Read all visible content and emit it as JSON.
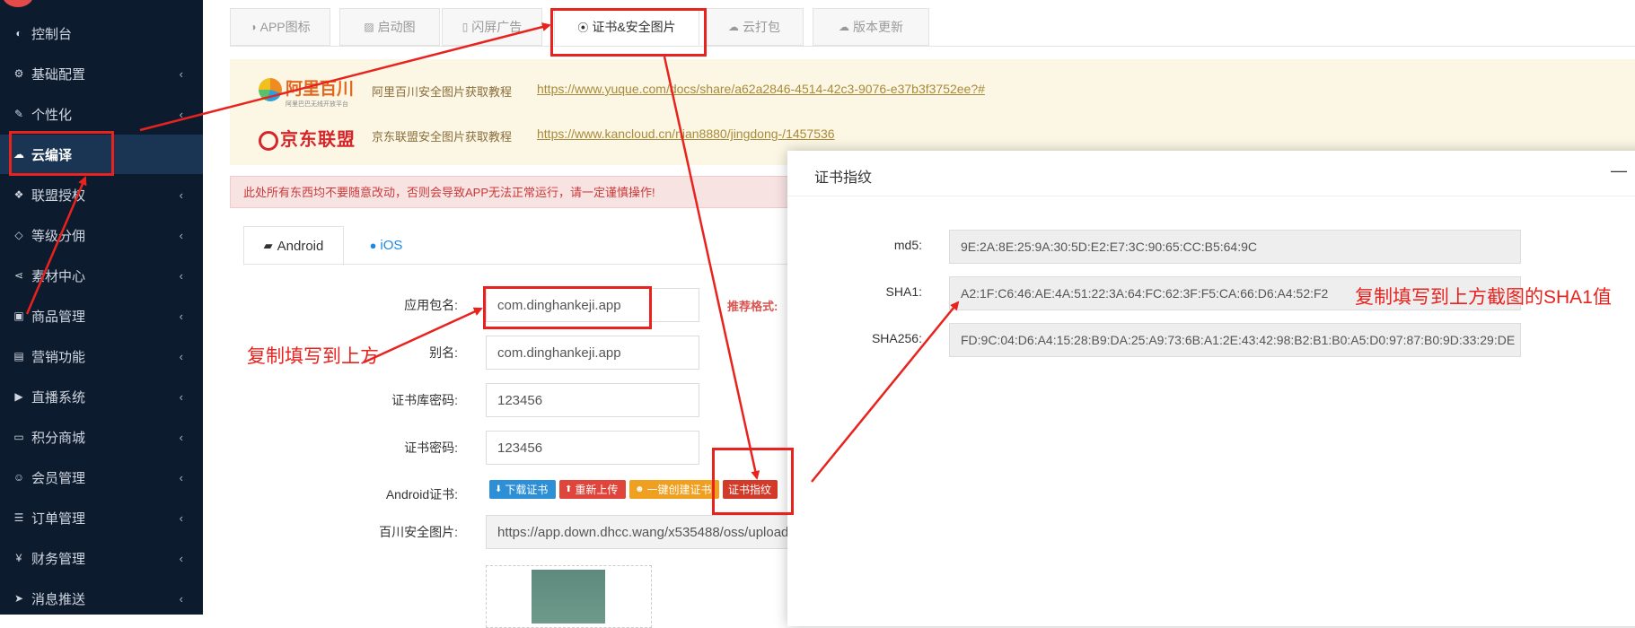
{
  "sidebar": {
    "items": [
      {
        "label": "控制台",
        "icon": "dashboard-icon",
        "glyph": "◐",
        "chevron": false
      },
      {
        "label": "基础配置",
        "icon": "cogs-icon",
        "glyph": "⚙",
        "chevron": true
      },
      {
        "label": "个性化",
        "icon": "magic-wand-icon",
        "glyph": "✎",
        "chevron": true
      },
      {
        "label": "云编译",
        "icon": "cloud-icon",
        "glyph": "☁",
        "chevron": false
      },
      {
        "label": "联盟授权",
        "icon": "cubes-icon",
        "glyph": "❖",
        "chevron": true
      },
      {
        "label": "等级分佣",
        "icon": "diamond-icon",
        "glyph": "◇",
        "chevron": true
      },
      {
        "label": "素材中心",
        "icon": "share-icon",
        "glyph": "⋖",
        "chevron": true
      },
      {
        "label": "商品管理",
        "icon": "briefcase-icon",
        "glyph": "▣",
        "chevron": true
      },
      {
        "label": "营销功能",
        "icon": "gift-icon",
        "glyph": "▤",
        "chevron": true
      },
      {
        "label": "直播系统",
        "icon": "video-camera-icon",
        "glyph": "▶",
        "chevron": true
      },
      {
        "label": "积分商城",
        "icon": "jcb-card-icon",
        "glyph": "▭",
        "chevron": true
      },
      {
        "label": "会员管理",
        "icon": "user-card-icon",
        "glyph": "☺",
        "chevron": true
      },
      {
        "label": "订单管理",
        "icon": "list-icon",
        "glyph": "☰",
        "chevron": true
      },
      {
        "label": "财务管理",
        "icon": "yen-icon",
        "glyph": "¥",
        "chevron": true
      },
      {
        "label": "消息推送",
        "icon": "paper-plane-icon",
        "glyph": "➤",
        "chevron": true
      }
    ],
    "chevron_glyph": "‹",
    "active_index": 3
  },
  "tabs": [
    {
      "label": "APP图标",
      "icon": "◑"
    },
    {
      "label": "启动图",
      "icon": "▨"
    },
    {
      "label": "闪屏广告",
      "icon": "▯"
    },
    {
      "label": "证书&安全图片",
      "icon": "⦿"
    },
    {
      "label": "云打包",
      "icon": "☁"
    },
    {
      "label": "版本更新",
      "icon": "☁"
    }
  ],
  "banner": {
    "alibaba": {
      "logo_text": "阿里百川",
      "logo_sub": "阿里巴巴无线开放平台",
      "desc": "阿里百川安全图片获取教程",
      "link": "https://www.yuque.com/docs/share/a62a2846-4514-42c3-9076-e37b3f3752ee?#"
    },
    "jd": {
      "logo_text": "京东联盟",
      "desc": "京东联盟安全图片获取教程",
      "link": "https://www.kancloud.cn/nian8880/jingdong-/1457536"
    }
  },
  "warning": "此处所有东西均不要随意改动，否则会导致APP无法正常运行，请一定谨慎操作!",
  "platform_tabs": {
    "android": "Android",
    "ios": "iOS"
  },
  "form": {
    "package_label": "应用包名:",
    "package_value": "com.dinghankeji.app",
    "alias_label": "别名:",
    "alias_value": "com.dinghankeji.app",
    "keystore_pwd_label": "证书库密码:",
    "keystore_pwd_value": "123456",
    "cert_pwd_label": "证书密码:",
    "cert_pwd_value": "123456",
    "android_cert_label": "Android证书:",
    "baichuan_label": "百川安全图片:",
    "baichuan_value": "https://app.down.dhcc.wang/x535488/oss/upload",
    "hint": "推荐格式:"
  },
  "buttons": {
    "download": "下载证书",
    "reupload": "重新上传",
    "create": "一键创建证书",
    "fingerprint": "证书指纹"
  },
  "modal": {
    "title": "证书指纹",
    "minimize": "—",
    "md5_label": "md5:",
    "md5_value": "9E:2A:8E:25:9A:30:5D:E2:E7:3C:90:65:CC:B5:64:9C",
    "sha1_label": "SHA1:",
    "sha1_value": "A2:1F:C6:46:AE:4A:51:22:3A:64:FC:62:3F:F5:CA:66:D6:A4:52:F2",
    "sha256_label": "SHA256:",
    "sha256_value": "FD:9C:04:D6:A4:15:28:B9:DA:25:A9:73:6B:A1:2E:43:42:98:B2:B1:B0:A5:D0:97:87:B0:9D:33:29:DE"
  },
  "annotations": {
    "copy_to_above": "复制填写到上方",
    "copy_sha1": "复制填写到上方截图的SHA1值"
  },
  "colors": {
    "annotation_red": "#e8231e",
    "sidebar_bg": "#0d1b2e",
    "sidebar_active": "#1a3553",
    "banner_bg": "#fcf7e4"
  }
}
